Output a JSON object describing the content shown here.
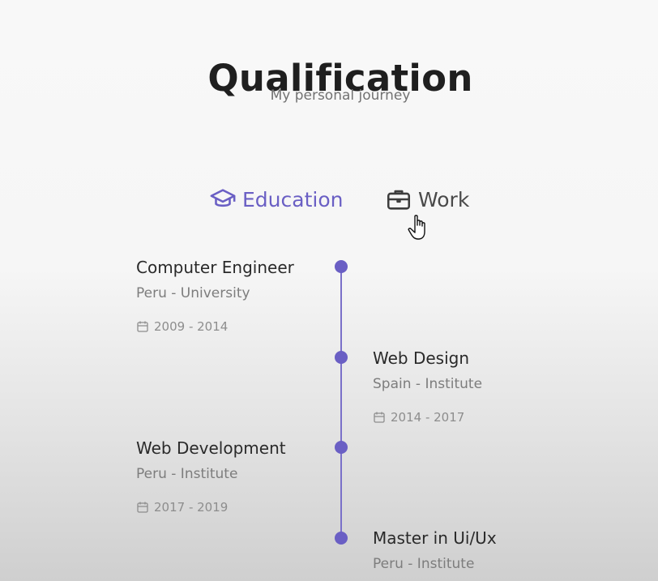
{
  "header": {
    "title": "Qualification",
    "subtitle": "My personal journey"
  },
  "tabs": [
    {
      "label": "Education",
      "icon": "graduation-cap-icon",
      "active": true
    },
    {
      "label": "Work",
      "icon": "briefcase-icon",
      "active": false
    }
  ],
  "timeline": [
    {
      "role": "Computer Engineer",
      "place": "Peru - University",
      "date": "2009 - 2014",
      "side": "left"
    },
    {
      "role": "Web Design",
      "place": "Spain - Institute",
      "date": "2014 - 2017",
      "side": "right"
    },
    {
      "role": "Web Development",
      "place": "Peru - Institute",
      "date": "2017 - 2019",
      "side": "left"
    },
    {
      "role": "Master in Ui/Ux",
      "place": "Peru - Institute",
      "date": "",
      "side": "right"
    }
  ],
  "colors": {
    "accent": "#6a5fc4",
    "text": "#2b2b2b",
    "muted": "#7d7d7d"
  }
}
